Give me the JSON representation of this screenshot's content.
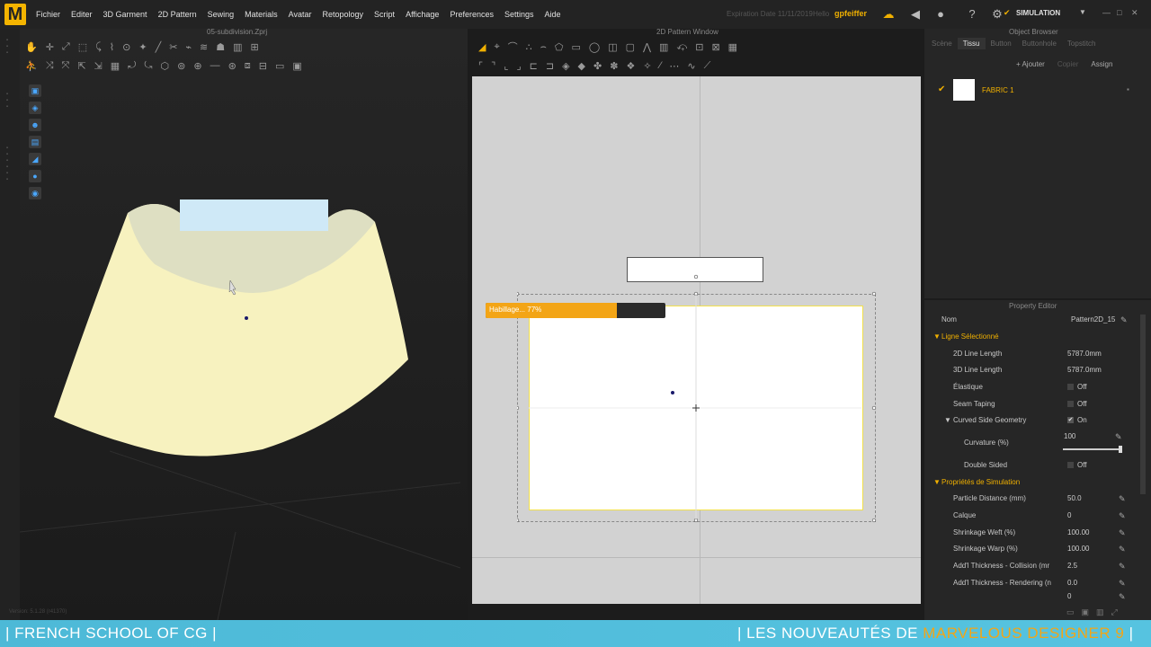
{
  "app": {
    "logo": "M",
    "menu": [
      "Fichier",
      "Editer",
      "3D Garment",
      "2D Pattern",
      "Sewing",
      "Materials",
      "Avatar",
      "Retopology",
      "Script",
      "Affichage",
      "Preferences",
      "Settings",
      "Aide"
    ],
    "expiration": "Expiration Date 11/11/2019",
    "user_label": "Hello",
    "user": "gpfeiffer",
    "simulation_label": "SIMULATION"
  },
  "viewport3d": {
    "file_title": "05-subdivision.Zprj",
    "version": "Version: 5.1.28 (r41370)"
  },
  "pattern2d": {
    "title": "2D Pattern Window",
    "progress_label": "Habillage... 77%",
    "progress": 0.73
  },
  "object_browser": {
    "title": "Object Browser",
    "tabs": [
      "Scène",
      "Tissu",
      "Button",
      "Buttonhole",
      "Topstitch"
    ],
    "active_tab": "Tissu",
    "actions": {
      "add": "+ Ajouter",
      "copy": "Copier",
      "assign": "Assign"
    },
    "fabric_name": "FABRIC 1"
  },
  "property_editor": {
    "title": "Property Editor",
    "name_label": "Nom",
    "name_value": "Pattern2D_15",
    "section1": "Ligne Sélectionné",
    "rows1": [
      {
        "label": "2D Line Length",
        "value": "5787.0mm"
      },
      {
        "label": "3D Line Length",
        "value": "5787.0mm"
      },
      {
        "label": "Élastique",
        "value": "Off"
      },
      {
        "label": "Seam Taping",
        "value": "Off"
      },
      {
        "label": "Curved Side Geometry",
        "value": "On"
      },
      {
        "label": "Curvature (%)",
        "value": "100"
      },
      {
        "label": "Double Sided",
        "value": "Off"
      }
    ],
    "section2": "Propriétés de Simulation",
    "rows2": [
      {
        "label": "Particle Distance (mm)",
        "value": "50.0"
      },
      {
        "label": "Calque",
        "value": "0"
      },
      {
        "label": "Shrinkage Weft (%)",
        "value": "100.00"
      },
      {
        "label": "Shrinkage Warp (%)",
        "value": "100.00"
      },
      {
        "label": "Add'l Thickness - Collision (mr",
        "value": "2.5"
      },
      {
        "label": "Add'l Thickness - Rendering (n",
        "value": "0.0"
      },
      {
        "label": "",
        "value": "0"
      }
    ]
  },
  "banner": {
    "left": "| FRENCH SCHOOL OF CG |",
    "right_prefix": "| LES NOUVEAUTÉS DE ",
    "right_highlight": "MARVELOUS DESIGNER 9",
    "right_suffix": " |"
  },
  "colors": {
    "accent": "#f0b000",
    "progress": "#f3a516",
    "banner": "#4db9d7",
    "fabric_3d": "#f7f2bf"
  }
}
